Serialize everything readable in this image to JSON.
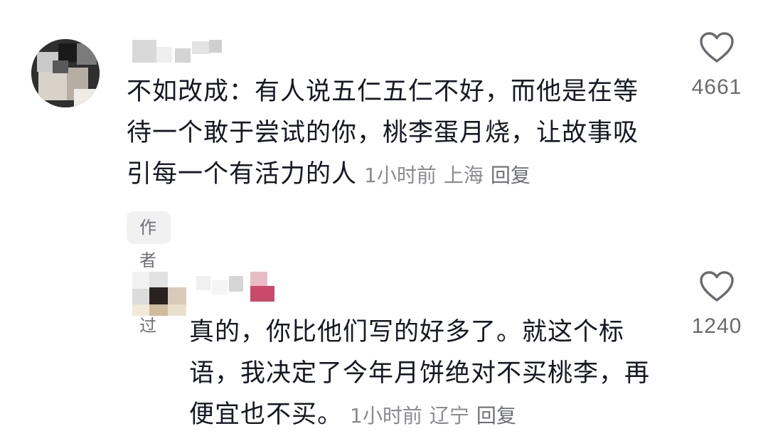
{
  "comments": [
    {
      "text": "不如改成：有人说五仁五仁不好，而他是在等待一个敢于尝试的你，桃李蛋月烧，让故事吸引每一个有活力的人",
      "time": "1小时前",
      "location": "上海",
      "reply_label": "回复",
      "badge": "作者赞过",
      "likes": "4661",
      "like_icon": "heart-outline-icon"
    },
    {
      "text": "真的，你比他们写的好多了。就这个标语，我决定了今年月饼绝对不买桃李，再便宜也不买。",
      "time": "1小时前",
      "location": "辽宁",
      "reply_label": "回复",
      "likes": "1240",
      "like_icon": "heart-outline-icon"
    }
  ],
  "colors": {
    "text_primary": "#161823",
    "text_meta": "#8a8b91",
    "badge_bg": "#f1f1f2",
    "heart_stroke": "#6a6b70"
  }
}
